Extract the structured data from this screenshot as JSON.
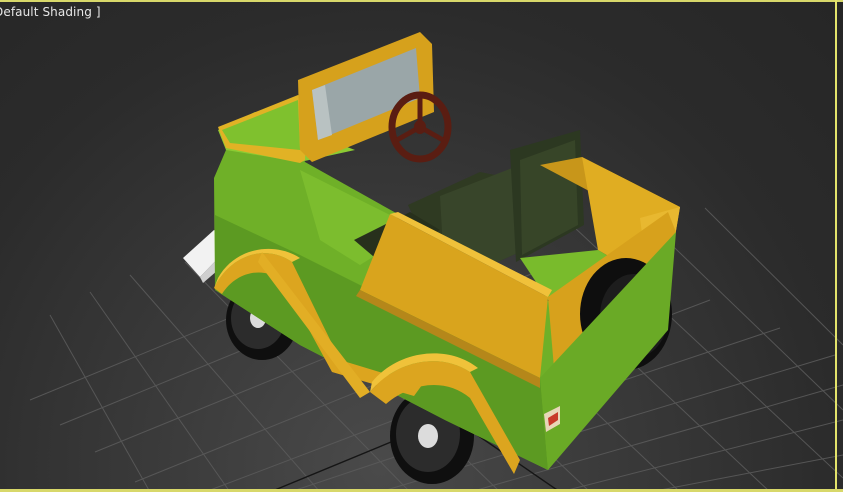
{
  "viewport": {
    "label": "Default Shading ]",
    "shading_mode": "Default Shading",
    "background_color": "#2e2e2e",
    "grid_color": "#5a5a5a",
    "active_border_color": "#e3e36b"
  },
  "model": {
    "icons": {
      "vehicle": "toy-jeep-icon",
      "steering_wheel": "steering-wheel-icon",
      "wheel": "wheel-icon"
    },
    "colors": {
      "body_green": "#72b52a",
      "body_green_dark": "#4f8d1c",
      "trim_yellow": "#d8a21b",
      "trim_yellow_light": "#e9bd2f",
      "seat_dark": "#2f3a22",
      "steering_wheel": "#5a1d12",
      "tire": "#151515",
      "windshield_glass": "#9aa6a8"
    }
  }
}
